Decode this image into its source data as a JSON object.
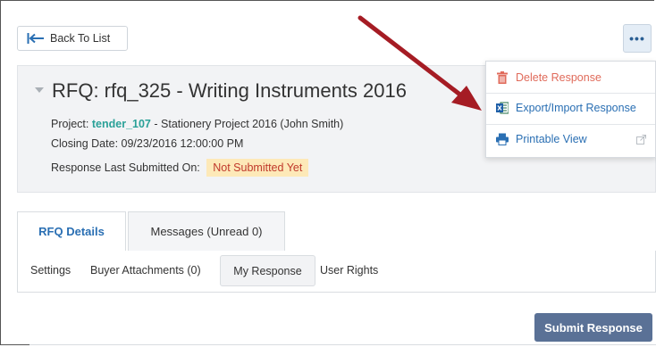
{
  "toolbar": {
    "back_label": "Back To List",
    "more_label": "•••"
  },
  "header": {
    "title": "RFQ: rfq_325 - Writing Instruments 2016",
    "project_label": "Project:",
    "project_link": "tender_107",
    "project_rest": " - Stationery Project 2016 (John Smith)",
    "closing_date": "Closing Date: 09/23/2016 12:00:00 PM",
    "submitted_label": "Response Last Submitted On:",
    "submitted_status": "Not Submitted Yet"
  },
  "menu": {
    "delete": "Delete Response",
    "export": "Export/Import Response",
    "printable": "Printable View"
  },
  "tabs": [
    {
      "label": "RFQ Details"
    },
    {
      "label": "Messages (Unread 0)"
    }
  ],
  "subnav": [
    {
      "label": "Settings"
    },
    {
      "label": "Buyer Attachments (0)"
    },
    {
      "label": "My Response"
    },
    {
      "label": "User Rights"
    }
  ],
  "actions": {
    "submit": "Submit Response"
  },
  "colors": {
    "accent": "#2a6fb3",
    "teal_link": "#2aa198",
    "danger": "#e06b5b",
    "badge_bg": "#fde9b8",
    "submit_bg": "#5a7196",
    "annotation_arrow": "#a51c24"
  }
}
